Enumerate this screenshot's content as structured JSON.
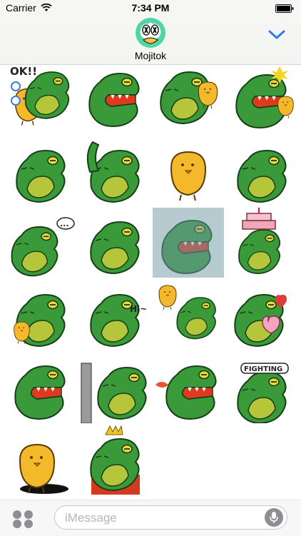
{
  "status_bar": {
    "carrier": "Carrier",
    "time": "7:34 PM",
    "wifi_icon": "wifi-icon",
    "battery_icon": "battery-icon"
  },
  "header": {
    "app_name": "Mojitok",
    "app_icon": "mojitok-logo-icon",
    "collapse_icon": "chevron-down-icon",
    "accent_color": "#2f7de1"
  },
  "stickers": [
    {
      "label": "OK!!"
    },
    {
      "label": ""
    },
    {
      "label": ""
    },
    {
      "label": ""
    },
    {
      "label": ""
    },
    {
      "label": ""
    },
    {
      "label": ""
    },
    {
      "label": ""
    },
    {
      "label": "..."
    },
    {
      "label": ""
    },
    {
      "label": ""
    },
    {
      "label": ""
    },
    {
      "label": ""
    },
    {
      "label": "Hi~"
    },
    {
      "label": ""
    },
    {
      "label": ""
    },
    {
      "label": ""
    },
    {
      "label": ""
    },
    {
      "label": ""
    },
    {
      "label": "FIGHTING"
    },
    {
      "label": ""
    },
    {
      "label": ""
    }
  ],
  "colors": {
    "croc_green": "#3a9a3a",
    "croc_dark": "#1f6b2a",
    "croc_belly": "#b6c63a",
    "mouth_red": "#e03a1e",
    "chick_yellow": "#f4b92a"
  },
  "bottom_bar": {
    "apps_icon": "app-drawer-icon",
    "input_placeholder": "iMessage",
    "mic_icon": "microphone-icon"
  }
}
